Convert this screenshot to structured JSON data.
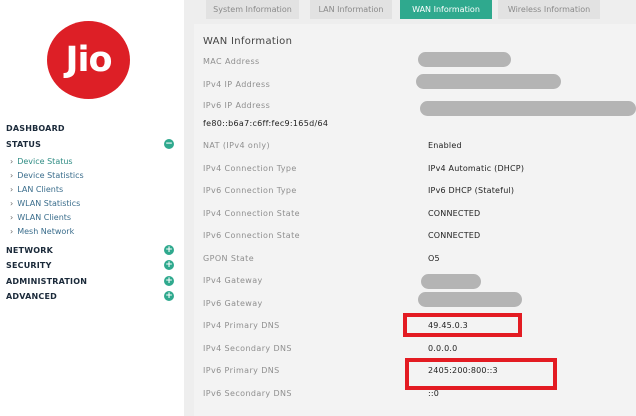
{
  "logo": {
    "text": "Jio"
  },
  "sidebar": {
    "dashboard": "DASHBOARD",
    "status": "STATUS",
    "status_items": [
      "Device Status",
      "Device Statistics",
      "LAN Clients",
      "WLAN Statistics",
      "WLAN Clients",
      "Mesh Network"
    ],
    "network": "NETWORK",
    "security": "SECURITY",
    "administration": "ADMINISTRATION",
    "advanced": "ADVANCED",
    "expand_symbol": "+",
    "collapse_symbol": "−"
  },
  "tabs": [
    "System Information",
    "LAN Information",
    "WAN Information",
    "Wireless Information"
  ],
  "wan": {
    "title": "WAN Information",
    "labels": {
      "mac": "MAC Address",
      "ipv4": "IPv4 IP Address",
      "ipv6": "IPv6 IP Address",
      "nat": "NAT (IPv4 only)",
      "ipv4_type": "IPv4 Connection Type",
      "ipv6_type": "IPv6 Connection Type",
      "ipv4_state": "IPv4 Connection State",
      "ipv6_state": "IPv6 Connection State",
      "gpon": "GPON State",
      "ipv4_gw": "IPv4 Gateway",
      "ipv6_gw": "IPv6 Gateway",
      "ipv4_dns1": "IPv4 Primary DNS",
      "ipv4_dns2": "IPv4 Secondary DNS",
      "ipv6_dns1": "IPv6 Primary DNS",
      "ipv6_dns2": "IPv6 Secondary DNS"
    },
    "values": {
      "ipv6_partial": "fe80::b6a7:c6ff:fec9:165d/64",
      "nat": "Enabled",
      "ipv4_type": "IPv4 Automatic (DHCP)",
      "ipv6_type": "IPv6 DHCP (Stateful)",
      "ipv4_state": "CONNECTED",
      "ipv6_state": "CONNECTED",
      "gpon": "O5",
      "ipv4_dns1": "49.45.0.3",
      "ipv4_dns2": "0.0.0.0",
      "ipv6_dns1": "2405:200:800::3",
      "ipv6_dns2": "::0"
    }
  },
  "colors": {
    "brand_red": "#dd1f26",
    "accent_teal": "#2fa98e",
    "highlight_red": "#e31b22"
  }
}
